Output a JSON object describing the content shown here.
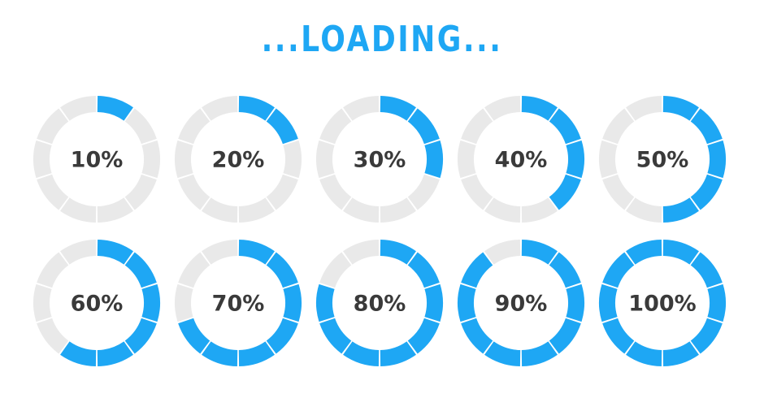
{
  "title": "...LOADING...",
  "colors": {
    "accent": "#1ea7f4",
    "track": "#e9e9e9",
    "label": "#3a3a3a",
    "background": "#ffffff"
  },
  "segments_per_ring": 10,
  "indicators": [
    {
      "label": "10%",
      "progress": 0.1
    },
    {
      "label": "20%",
      "progress": 0.2
    },
    {
      "label": "30%",
      "progress": 0.3
    },
    {
      "label": "40%",
      "progress": 0.4
    },
    {
      "label": "50%",
      "progress": 0.5
    },
    {
      "label": "60%",
      "progress": 0.6
    },
    {
      "label": "70%",
      "progress": 0.7
    },
    {
      "label": "80%",
      "progress": 0.8
    },
    {
      "label": "90%",
      "progress": 0.9
    },
    {
      "label": "100%",
      "progress": 1.0
    }
  ]
}
